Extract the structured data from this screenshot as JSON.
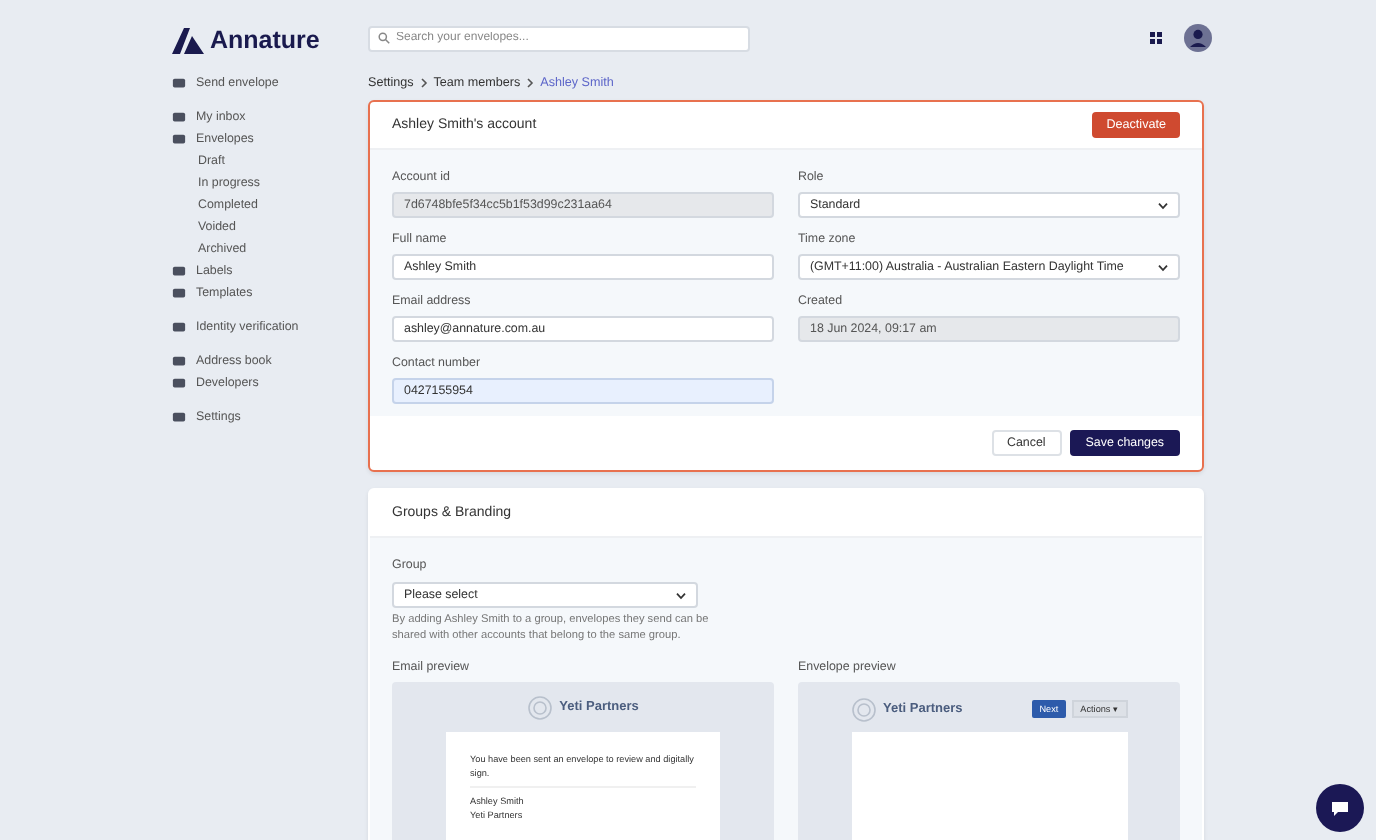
{
  "brand": {
    "name": "Annature"
  },
  "search": {
    "placeholder": "Search your envelopes..."
  },
  "sidebar": {
    "groups": [
      {
        "items": [
          {
            "label": "Send envelope",
            "selected": false
          }
        ]
      },
      {
        "items": [
          {
            "label": "My inbox",
            "selected": false
          },
          {
            "label": "Envelopes",
            "selected": false,
            "children": [
              {
                "label": "Draft",
                "selected": false
              },
              {
                "label": "In progress",
                "selected": false
              },
              {
                "label": "Completed",
                "selected": false
              },
              {
                "label": "Voided",
                "selected": false
              },
              {
                "label": "Archived",
                "selected": false
              }
            ]
          },
          {
            "label": "Labels",
            "selected": false
          },
          {
            "label": "Templates",
            "selected": false
          }
        ]
      },
      {
        "items": [
          {
            "label": "Identity verification",
            "selected": false
          }
        ]
      },
      {
        "items": [
          {
            "label": "Address book",
            "selected": false
          },
          {
            "label": "Developers",
            "selected": false
          }
        ]
      },
      {
        "items": [
          {
            "label": "Settings",
            "selected": false
          }
        ]
      }
    ]
  },
  "breadcrumb": [
    {
      "label": "Settings",
      "current": false
    },
    {
      "label": "Team members",
      "current": false
    },
    {
      "label": "Ashley Smith",
      "current": true
    }
  ],
  "account": {
    "title": "Ashley Smith's account",
    "deactivate": "Deactivate",
    "left_fields": [
      {
        "label": "Account id",
        "kind": "readonly",
        "value": "7d6748bfe5f34cc5b1f53d99c231aa64",
        "focused": false
      },
      {
        "label": "Full name",
        "kind": "text",
        "value": "Ashley Smith",
        "focused": false
      },
      {
        "label": "Email address",
        "kind": "text",
        "value": "ashley@annature.com.au",
        "focused": false
      },
      {
        "label": "Contact number",
        "kind": "text",
        "value": "0427155954",
        "focused": true
      }
    ],
    "right_fields": [
      {
        "label": "Role",
        "kind": "select",
        "value": "Standard",
        "focused": false
      },
      {
        "label": "Time zone",
        "kind": "select",
        "value": "(GMT+11:00) Australia - Australian Eastern Daylight Time",
        "focused": false
      },
      {
        "label": "Created",
        "kind": "readonly",
        "value": "18 Jun 2024, 09:17 am",
        "focused": false
      }
    ],
    "cancel": "Cancel",
    "save": "Save changes"
  },
  "groups": {
    "title": "Groups & Branding",
    "group_label": "Group",
    "group_placeholder": "Please select",
    "help": "By adding Ashley Smith to a group, envelopes they send can be shared with other accounts that belong to the same group.",
    "email_preview": {
      "label": "Email preview",
      "company": "Yeti Partners",
      "message": "You have been sent an envelope to review and digitally sign.",
      "sender_name": "Ashley Smith",
      "sender_company": "Yeti Partners"
    },
    "envelope_preview": {
      "label": "Envelope preview",
      "company": "Yeti Partners",
      "next": "Next",
      "actions": "Actions ▾"
    }
  }
}
